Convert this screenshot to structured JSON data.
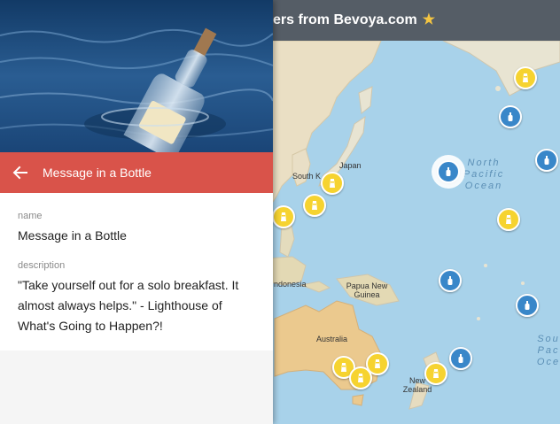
{
  "header": {
    "title": "ers from Bevoya.com",
    "star_icon": "star-icon",
    "star_color": "#f4c542"
  },
  "panel": {
    "title": "Message in a Bottle",
    "header_color": "#d9534a",
    "back_icon": "back-arrow-icon",
    "hero_image": "message-in-a-bottle-photo",
    "fields": [
      {
        "label": "name",
        "value": "Message in a Bottle"
      },
      {
        "label": "description",
        "value": "\"Take yourself out for a solo breakfast. It almost always helps.\" - Lighthouse of What's Going to Happen?!"
      }
    ]
  },
  "map": {
    "labels": {
      "japan": "Japan",
      "south_korea": "South K",
      "indonesia": "ndonesia",
      "png": "Papua New Guinea",
      "australia": "Australia",
      "new_zealand": "New Zealand"
    },
    "oceans": {
      "north_pacific": "North Pacific Ocean",
      "south_pacific": "Sou Pac Oce"
    },
    "marker_colors": {
      "lighthouse": "#f6d330",
      "bottle": "#3987c9"
    },
    "marker_icons": {
      "lighthouse": "lighthouse-icon",
      "bottle": "bottle-icon"
    }
  }
}
